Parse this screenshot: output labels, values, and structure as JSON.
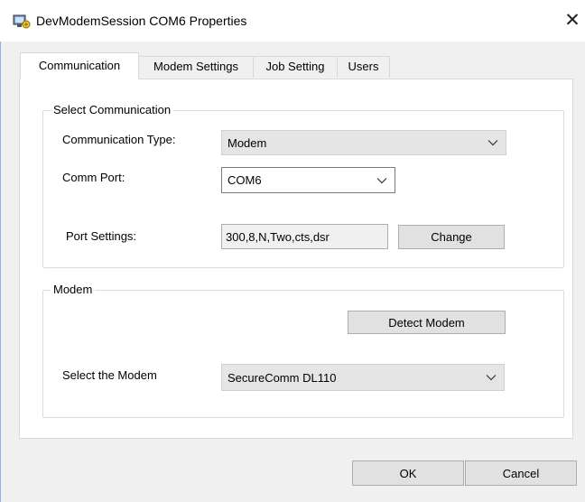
{
  "window": {
    "title": "DevModemSession COM6 Properties",
    "close_glyph": "✕"
  },
  "tabs": [
    {
      "label": "Communication",
      "active": true
    },
    {
      "label": "Modem Settings",
      "active": false
    },
    {
      "label": "Job Setting",
      "active": false
    },
    {
      "label": "Users",
      "active": false
    }
  ],
  "select_communication": {
    "legend": "Select Communication",
    "communication_type_label": "Communication Type:",
    "communication_type_value": "Modem",
    "comm_port_label": "Comm Port:",
    "comm_port_value": "COM6",
    "port_settings_label": "Port Settings:",
    "port_settings_value": "300,8,N,Two,cts,dsr",
    "change_button": "Change"
  },
  "modem": {
    "legend": "Modem",
    "detect_button": "Detect Modem",
    "select_label": "Select the Modem",
    "select_value": "SecureComm DL110"
  },
  "footer": {
    "ok_button": "OK",
    "cancel_button": "Cancel"
  },
  "colors": {
    "window_bg": "#f0f0f0",
    "panel_bg": "#ffffff",
    "button_bg": "#e1e1e1",
    "window_border": "#8ab4ee"
  }
}
